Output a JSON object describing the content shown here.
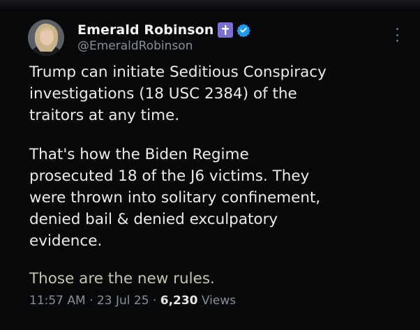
{
  "tweet": {
    "author": {
      "display_name": "Emerald Robinson",
      "handle": "@EmeraldRobinson",
      "badge_icon": "cross-badge-icon",
      "badge_color": "#7b6fd6",
      "verified_icon": "verified-checkmark-icon",
      "verified_color": "#1d9bf0"
    },
    "text": {
      "p1_lines": [
        "Trump can initiate Seditious Conspiracy",
        "investigations (18 USC 2384) of the",
        "traitors at any time."
      ],
      "p2_lines": [
        "That's how the Biden Regime",
        "prosecuted 18 of the J6 victims. They",
        "were thrown into solitary confinement,",
        "denied bail & denied exculpatory",
        "evidence."
      ],
      "p3": "Those are the new rules."
    },
    "meta": {
      "time": "11:57 AM",
      "separator": "·",
      "date": "23 Jul 25",
      "views_count": "6,230",
      "views_label": "Views"
    }
  },
  "colors": {
    "background": "#07080a",
    "text_primary": "#ececec",
    "text_secondary": "#8a8f96"
  }
}
